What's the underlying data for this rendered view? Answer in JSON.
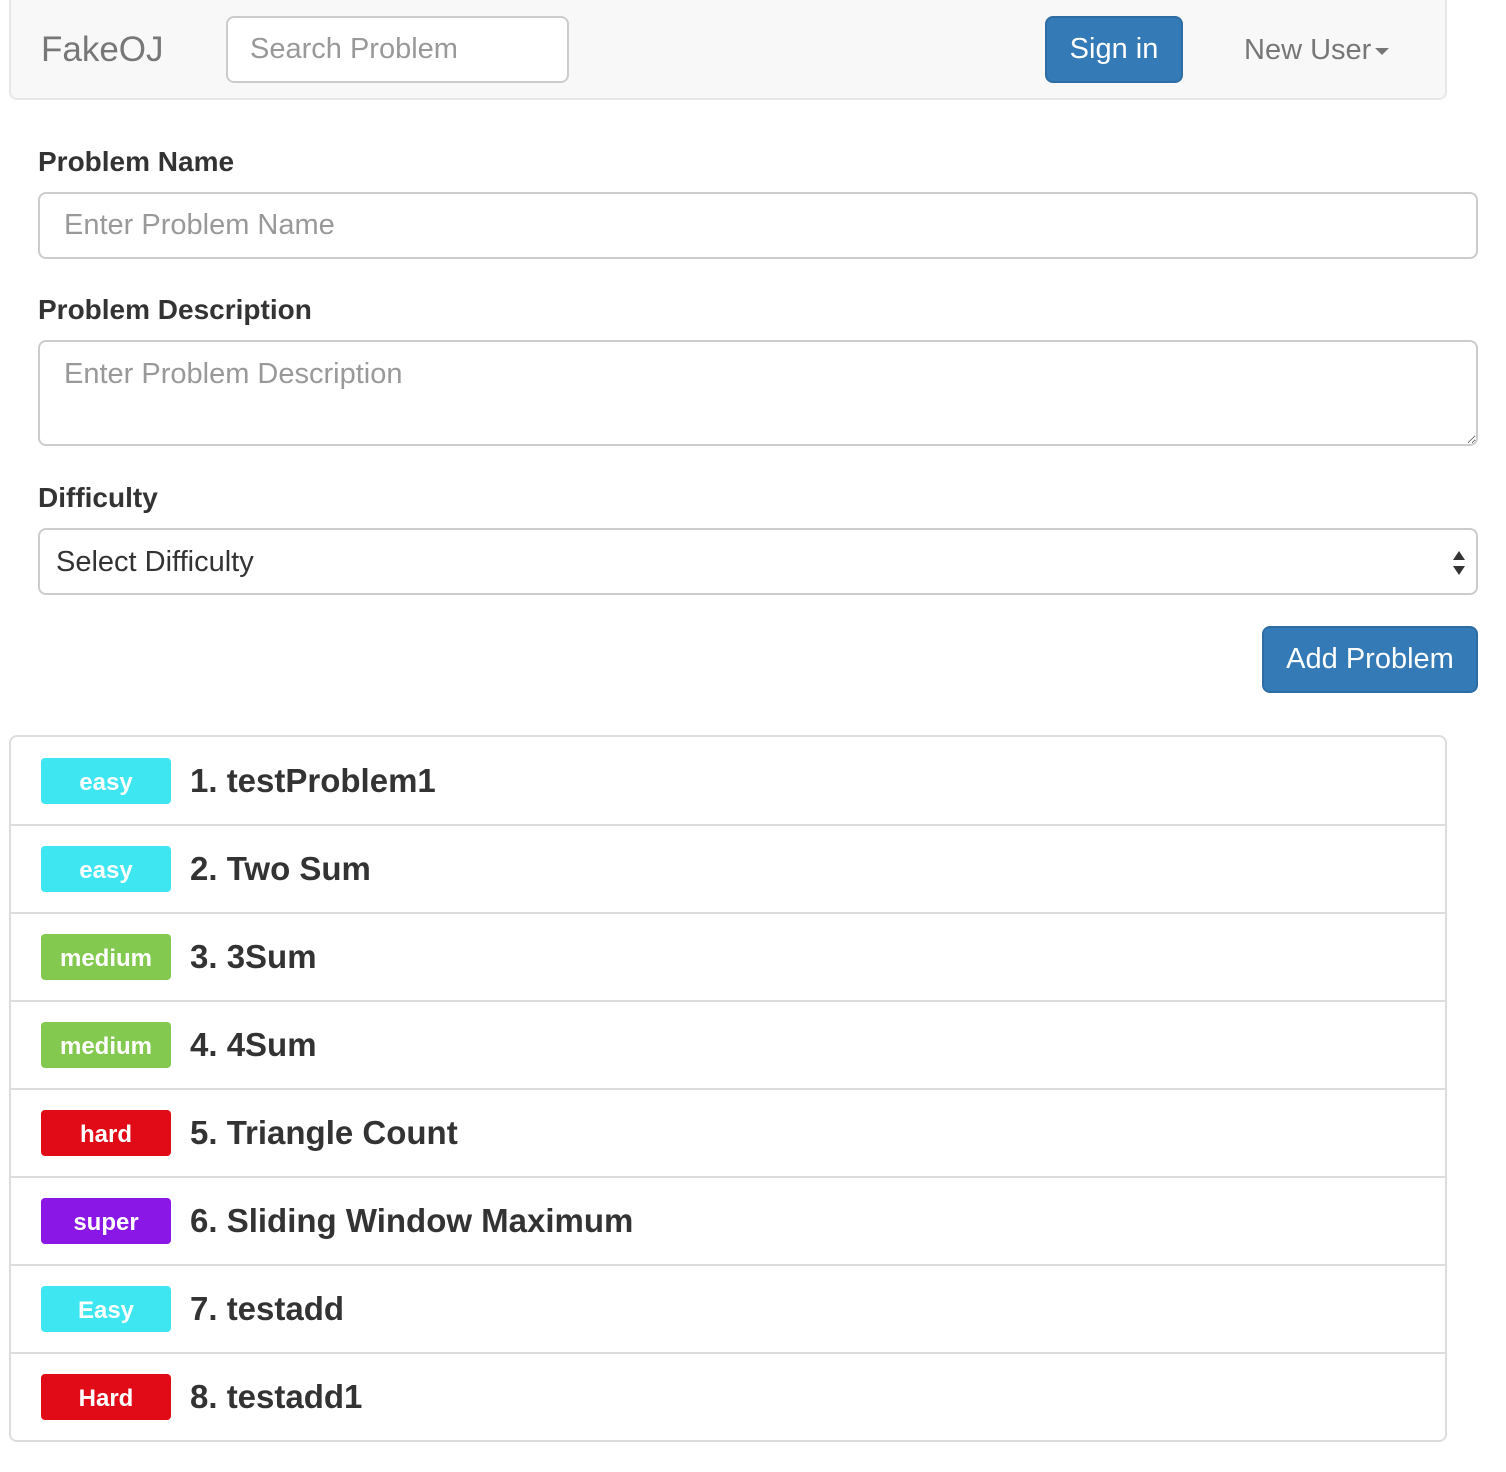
{
  "navbar": {
    "brand": "FakeOJ",
    "search_placeholder": "Search Problem",
    "signin_label": "Sign in",
    "user_menu_label": "New User"
  },
  "form": {
    "name_label": "Problem Name",
    "name_placeholder": "Enter Problem Name",
    "description_label": "Problem Description",
    "description_placeholder": "Enter Problem Description",
    "difficulty_label": "Difficulty",
    "difficulty_selected": "Select Difficulty",
    "submit_label": "Add Problem"
  },
  "colors": {
    "primary": "#337ab7",
    "easy": "#3ee6f2",
    "medium": "#84c94f",
    "hard": "#e00b17",
    "super": "#8a17e6"
  },
  "problems": [
    {
      "difficulty": "easy",
      "title": "1. testProblem1",
      "color": "#3ee6f2"
    },
    {
      "difficulty": "easy",
      "title": "2. Two Sum",
      "color": "#3ee6f2"
    },
    {
      "difficulty": "medium",
      "title": "3. 3Sum",
      "color": "#84c94f"
    },
    {
      "difficulty": "medium",
      "title": "4. 4Sum",
      "color": "#84c94f"
    },
    {
      "difficulty": "hard",
      "title": "5. Triangle Count",
      "color": "#e00b17"
    },
    {
      "difficulty": "super",
      "title": "6. Sliding Window Maximum",
      "color": "#8a17e6"
    },
    {
      "difficulty": "Easy",
      "title": "7. testadd",
      "color": "#3ee6f2"
    },
    {
      "difficulty": "Hard",
      "title": "8. testadd1",
      "color": "#e00b17"
    }
  ]
}
